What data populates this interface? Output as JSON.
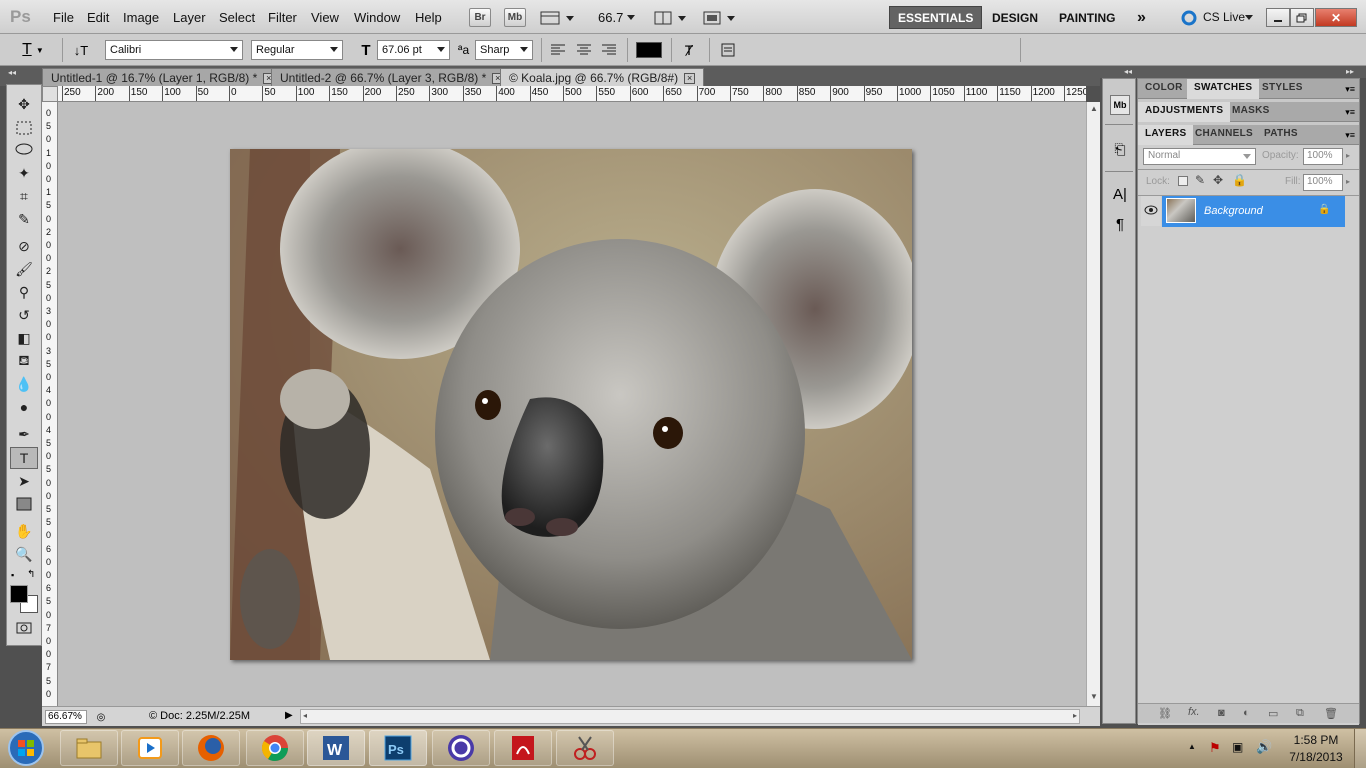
{
  "app": {
    "logo": "Ps"
  },
  "menu": [
    "File",
    "Edit",
    "Image",
    "Layer",
    "Select",
    "Filter",
    "View",
    "Window",
    "Help"
  ],
  "toolbar_buttons": {
    "bridge": "Br",
    "minibridge": "Mb",
    "zoom": "66.7"
  },
  "workspaces": {
    "essentials": "ESSENTIALS",
    "design": "DESIGN",
    "painting": "PAINTING",
    "more": "»",
    "cslive": "CS Live"
  },
  "options": {
    "font_family": "Calibri",
    "font_style": "Regular",
    "font_size": "67.06 pt",
    "aa_label": "ªa",
    "antialias": "Sharp",
    "text_color": "#000000"
  },
  "tabs": [
    {
      "label": "Untitled-1 @ 16.7% (Layer 1, RGB/8) *"
    },
    {
      "label": "Untitled-2 @ 66.7% (Layer 3, RGB/8) *"
    },
    {
      "label": "© Koala.jpg @ 66.7% (RGB/8#)"
    }
  ],
  "ruler_top": [
    "250",
    "200",
    "150",
    "100",
    "50",
    "0",
    "50",
    "100",
    "150",
    "200",
    "250",
    "300",
    "350",
    "400",
    "450",
    "500",
    "550",
    "600",
    "650",
    "700",
    "750",
    "800",
    "850",
    "900",
    "950",
    "1000",
    "1050",
    "1100",
    "1150",
    "1200",
    "1250"
  ],
  "ruler_left": [
    "0",
    "5",
    "0",
    "1",
    "0",
    "0",
    "1",
    "5",
    "0",
    "2",
    "0",
    "0",
    "2",
    "5",
    "0",
    "3",
    "0",
    "0",
    "3",
    "5",
    "0",
    "4",
    "0",
    "0",
    "4",
    "5",
    "0",
    "5",
    "0",
    "0",
    "5",
    "5",
    "0",
    "6",
    "0",
    "0",
    "6",
    "5",
    "0",
    "7",
    "0",
    "0",
    "7",
    "5",
    "0"
  ],
  "status": {
    "zoom": "66.67%",
    "doc": "Doc: 2.25M/2.25M"
  },
  "panels": {
    "group1": [
      "COLOR",
      "SWATCHES",
      "STYLES"
    ],
    "group2": [
      "ADJUSTMENTS",
      "MASKS"
    ],
    "group3": [
      "LAYERS",
      "CHANNELS",
      "PATHS"
    ],
    "blend_mode": "Normal",
    "opacity_label": "Opacity:",
    "opacity": "100%",
    "lock_label": "Lock:",
    "fill_label": "Fill:",
    "fill": "100%",
    "layer_name": "Background"
  },
  "clock": {
    "time": "1:58 PM",
    "date": "7/18/2013"
  }
}
